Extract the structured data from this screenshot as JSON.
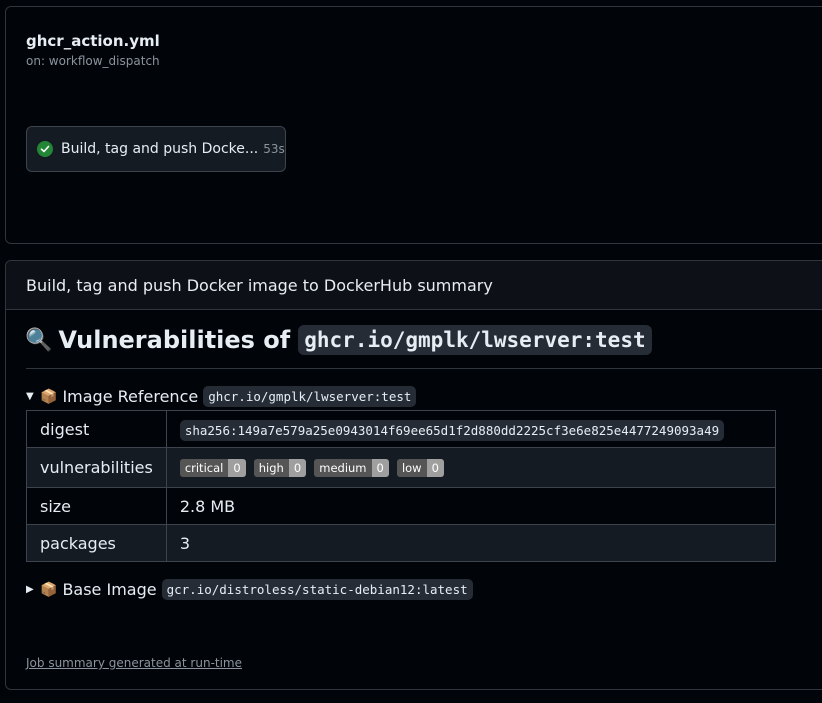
{
  "workflow": {
    "name": "ghcr_action.yml",
    "trigger": "on: workflow_dispatch",
    "job": {
      "name": "Build, tag and push Docke...",
      "duration": "53s",
      "status": "success"
    }
  },
  "summary": {
    "header": "Build, tag and push Docker image to DockerHub summary",
    "heading_prefix": "Vulnerabilities of",
    "heading_image": "ghcr.io/gmplk/lwserver:test",
    "image_reference": {
      "label": "Image Reference",
      "value": "ghcr.io/gmplk/lwserver:test",
      "expanded": true
    },
    "rows": [
      {
        "key": "digest",
        "value": "sha256:149a7e579a25e0943014f69ee65d1f2d880dd2225cf3e6e825e4477249093a49"
      },
      {
        "key": "vulnerabilities"
      },
      {
        "key": "size",
        "value": "2.8 MB"
      },
      {
        "key": "packages",
        "value": "3"
      }
    ],
    "badges": [
      {
        "label": "critical",
        "value": "0"
      },
      {
        "label": "high",
        "value": "0"
      },
      {
        "label": "medium",
        "value": "0"
      },
      {
        "label": "low",
        "value": "0"
      }
    ],
    "base_image": {
      "label": "Base Image",
      "value": "gcr.io/distroless/static-debian12:latest",
      "expanded": false
    },
    "footer": "Job summary generated at run-time"
  },
  "colors": {
    "background": "#010409",
    "success": "#238636",
    "badge_label": "#555555",
    "badge_value": "#9f9f9f"
  },
  "icons": {
    "job_status": "check-circle-icon",
    "heading": "magnifying-glass-icon",
    "image_reference": "package-icon",
    "base_image": "package-icon"
  }
}
